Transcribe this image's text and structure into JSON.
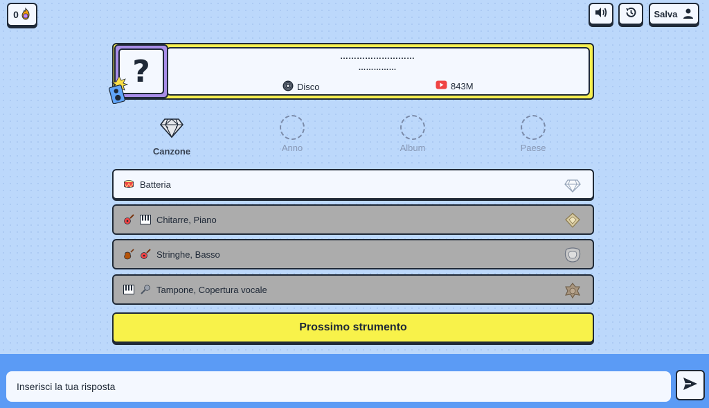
{
  "header": {
    "streak_count": "0",
    "streak_icon": "flame-hand-icon",
    "sound_icon": "speaker-icon",
    "history_icon": "history-icon",
    "save_label": "Salva",
    "save_icon": "user-icon"
  },
  "song": {
    "cover_placeholder": "?",
    "title_hidden": "………………………",
    "artist_hidden": "……………",
    "genre": "Disco",
    "genre_icon": "vinyl-record-icon",
    "views": "843M",
    "views_icon": "youtube-icon"
  },
  "categories": [
    {
      "label": "Canzone",
      "state": "active",
      "icon": "diamond-icon"
    },
    {
      "label": "Anno",
      "state": "empty"
    },
    {
      "label": "Album",
      "state": "empty"
    },
    {
      "label": "Paese",
      "state": "empty"
    }
  ],
  "instruments": [
    {
      "label": "Batteria",
      "icons": [
        "drum-icon"
      ],
      "state": "revealed",
      "badge": "diamond-badge-icon"
    },
    {
      "label": "Chitarre, Piano",
      "icons": [
        "guitar-icon",
        "piano-icon"
      ],
      "state": "locked",
      "badge": "gold-badge-icon"
    },
    {
      "label": "Stringhe, Basso",
      "icons": [
        "violin-icon",
        "guitar-icon"
      ],
      "state": "locked",
      "badge": "silver-badge-icon"
    },
    {
      "label": "Tampone, Copertura vocale",
      "icons": [
        "piano-icon",
        "microphone-icon"
      ],
      "state": "locked",
      "badge": "bronze-badge-icon"
    }
  ],
  "next_button_label": "Prossimo strumento",
  "answer": {
    "placeholder": "Inserisci la tua risposta",
    "value": ""
  },
  "colors": {
    "background": "#bcd8fb",
    "accent_yellow": "#f8f24a",
    "bottom_bar": "#5b9bf5",
    "locked_row": "#acacac"
  }
}
